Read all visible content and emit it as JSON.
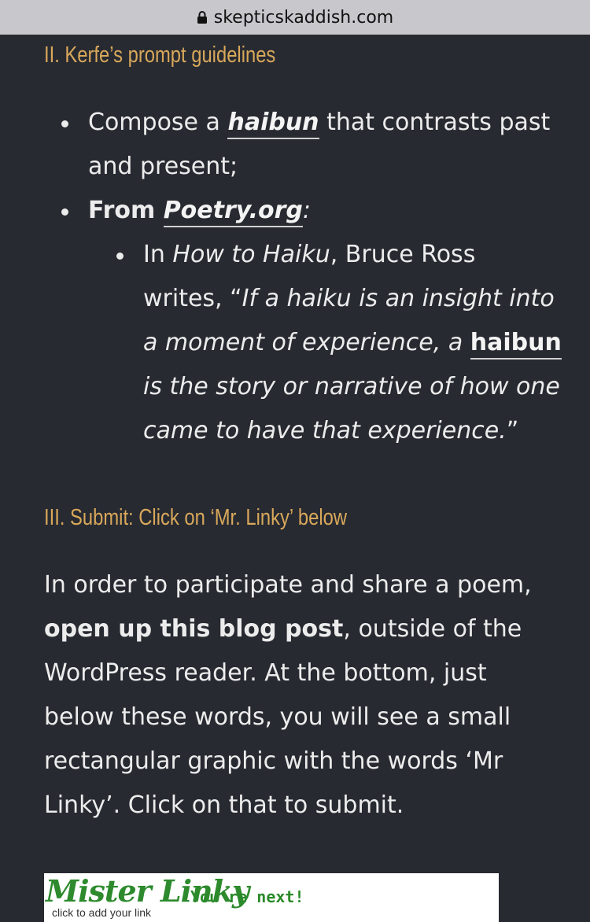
{
  "browser": {
    "url": "skepticskaddish.com"
  },
  "section2": {
    "heading": "II. Kerfe’s prompt guidelines",
    "item1": {
      "pre": "Compose a ",
      "link": "haibun",
      "post1": " that contrasts past",
      "post2": "and present;"
    },
    "item2": {
      "pre": "From ",
      "link": "Poetry.org",
      "post": ":"
    },
    "sub": {
      "l1_pre": "In ",
      "l1_it": "How to Haiku",
      "l1_post": ", Bruce Ross",
      "l2_pre": "writes, “",
      "l2_it": "If a haiku is an insight into",
      "l3_it": "a moment of experience, a ",
      "l3_link": "haibun",
      "l4_it": "is the story or narrative of how one",
      "l5_it": "came to have that experience.",
      "l5_post": "”"
    }
  },
  "section3": {
    "heading": "III. Submit: Click on ‘Mr. Linky’ below",
    "p_l1": "In order to participate and share a poem,",
    "p_l2_bold": "open up this blog post",
    "p_l2_post": ", outside of the",
    "p_l3": "WordPress reader. At the bottom, just",
    "p_l4": "below these words, you will see a small",
    "p_l5": "rectangular graphic with the words ‘Mr",
    "p_l6": "Linky’. Click on that to submit."
  },
  "misterlinky": {
    "logo": "Mister Linky",
    "sub": "click to add your link",
    "next": "You're next!"
  }
}
